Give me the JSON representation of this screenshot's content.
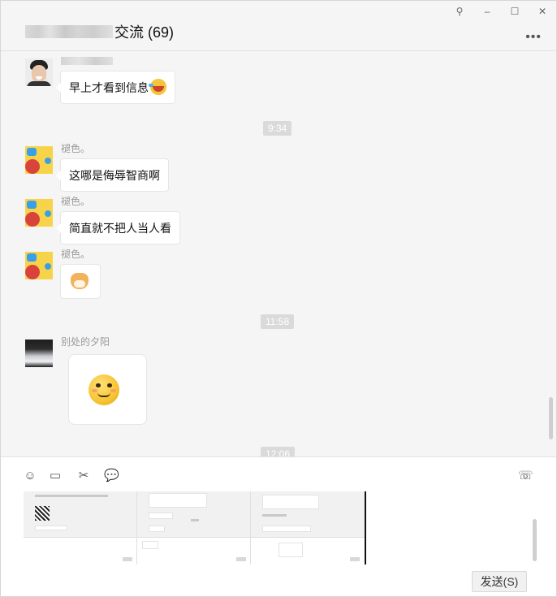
{
  "window": {
    "title_group": "交流 (69)",
    "controls": {
      "pin": "⚲",
      "minimize": "–",
      "maximize": "☐",
      "close": "✕"
    },
    "more": "•••"
  },
  "messages": [
    {
      "type": "text",
      "sender": "",
      "avatar": "person-avatar",
      "text": "早上才看到信息",
      "emoji": "laugh-crying-emoji"
    },
    {
      "type": "timestamp",
      "text": "9:34"
    },
    {
      "type": "text",
      "sender": "褪色。",
      "avatar": "yellow-cartoon-avatar",
      "text": "这哪是侮辱智商啊"
    },
    {
      "type": "text",
      "sender": "褪色。",
      "avatar": "yellow-cartoon-avatar",
      "text": "简直就不把人当人看"
    },
    {
      "type": "sticker",
      "sender": "褪色。",
      "avatar": "yellow-cartoon-avatar",
      "sticker": "cat-sticker"
    },
    {
      "type": "timestamp",
      "text": "11:58"
    },
    {
      "type": "sticker",
      "sender": "别处的夕阳",
      "avatar": "sunset-avatar",
      "sticker": "smile-emoji"
    },
    {
      "type": "timestamp",
      "text": "12:06"
    }
  ],
  "toolbar": {
    "emoji": "☺",
    "file": "▭",
    "screenshot": "✂",
    "chat_history": "💬",
    "video_call": "☏"
  },
  "composer": {
    "attachments": [
      "screenshot-thumbnail-1",
      "screenshot-thumbnail-2",
      "screenshot-thumbnail-3"
    ],
    "send_label": "发送(S)"
  }
}
